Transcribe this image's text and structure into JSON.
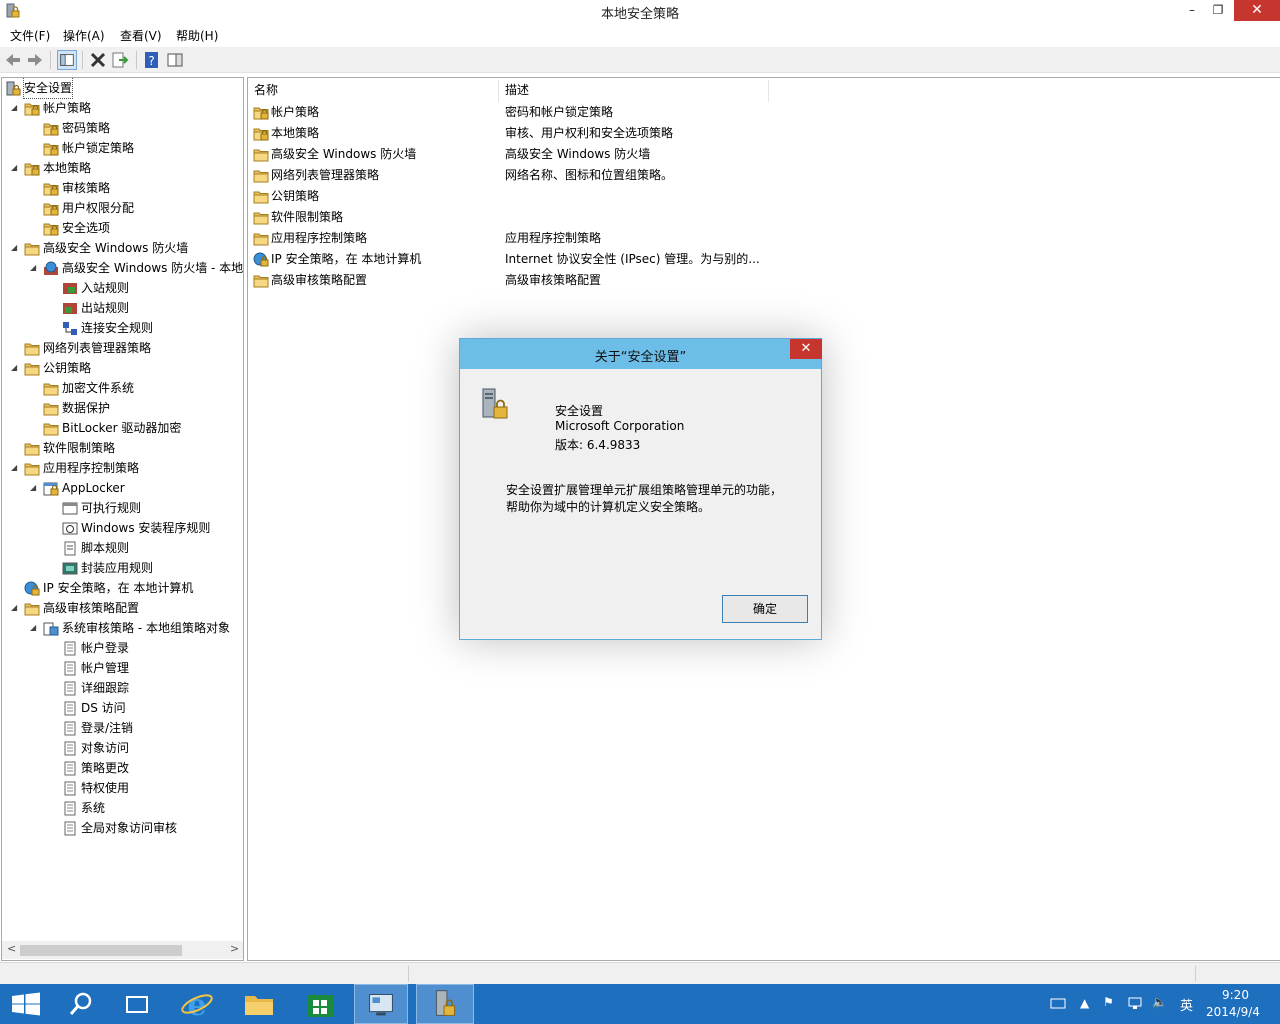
{
  "window": {
    "title": "本地安全策略",
    "minimize": "–",
    "maximize": "❐",
    "close": "✕"
  },
  "menu": [
    "文件(F)",
    "操作(A)",
    "查看(V)",
    "帮助(H)"
  ],
  "tree": [
    {
      "label": "安全设置",
      "depth": 0,
      "toggle": "",
      "icon": "security-settings-icon"
    },
    {
      "label": "帐户策略",
      "depth": 1,
      "toggle": "◢",
      "icon": "folder-lock-icon"
    },
    {
      "label": "密码策略",
      "depth": 2,
      "toggle": "",
      "icon": "folder-lock-icon"
    },
    {
      "label": "帐户锁定策略",
      "depth": 2,
      "toggle": "",
      "icon": "folder-lock-icon"
    },
    {
      "label": "本地策略",
      "depth": 1,
      "toggle": "◢",
      "icon": "folder-lock-icon"
    },
    {
      "label": "审核策略",
      "depth": 2,
      "toggle": "",
      "icon": "folder-lock-icon"
    },
    {
      "label": "用户权限分配",
      "depth": 2,
      "toggle": "",
      "icon": "folder-lock-icon"
    },
    {
      "label": "安全选项",
      "depth": 2,
      "toggle": "",
      "icon": "folder-lock-icon"
    },
    {
      "label": "高级安全 Windows 防火墙",
      "depth": 1,
      "toggle": "◢",
      "icon": "folder-icon"
    },
    {
      "label": "高级安全 Windows 防火墙 - 本地组策略对象",
      "depth": 2,
      "toggle": "◢",
      "icon": "firewall-icon"
    },
    {
      "label": "入站规则",
      "depth": 3,
      "toggle": "",
      "icon": "inbound-rules-icon"
    },
    {
      "label": "出站规则",
      "depth": 3,
      "toggle": "",
      "icon": "outbound-rules-icon"
    },
    {
      "label": "连接安全规则",
      "depth": 3,
      "toggle": "",
      "icon": "connection-rules-icon"
    },
    {
      "label": "网络列表管理器策略",
      "depth": 1,
      "toggle": "",
      "icon": "folder-icon"
    },
    {
      "label": "公钥策略",
      "depth": 1,
      "toggle": "◢",
      "icon": "folder-icon"
    },
    {
      "label": "加密文件系统",
      "depth": 2,
      "toggle": "",
      "icon": "folder-icon"
    },
    {
      "label": "数据保护",
      "depth": 2,
      "toggle": "",
      "icon": "folder-icon"
    },
    {
      "label": "BitLocker 驱动器加密",
      "depth": 2,
      "toggle": "",
      "icon": "folder-icon"
    },
    {
      "label": "软件限制策略",
      "depth": 1,
      "toggle": "",
      "icon": "folder-icon"
    },
    {
      "label": "应用程序控制策略",
      "depth": 1,
      "toggle": "◢",
      "icon": "folder-icon"
    },
    {
      "label": "AppLocker",
      "depth": 2,
      "toggle": "◢",
      "icon": "applocker-icon"
    },
    {
      "label": "可执行规则",
      "depth": 3,
      "toggle": "",
      "icon": "rules-icon"
    },
    {
      "label": "Windows 安装程序规则",
      "depth": 3,
      "toggle": "",
      "icon": "installer-rules-icon"
    },
    {
      "label": "脚本规则",
      "depth": 3,
      "toggle": "",
      "icon": "script-rules-icon"
    },
    {
      "label": "封装应用规则",
      "depth": 3,
      "toggle": "",
      "icon": "packaged-app-rules-icon"
    },
    {
      "label": "IP 安全策略，在 本地计算机",
      "depth": 1,
      "toggle": "",
      "icon": "ip-security-icon"
    },
    {
      "label": "高级审核策略配置",
      "depth": 1,
      "toggle": "◢",
      "icon": "folder-icon"
    },
    {
      "label": "系统审核策略 - 本地组策略对象",
      "depth": 2,
      "toggle": "◢",
      "icon": "audit-policy-icon"
    },
    {
      "label": "帐户登录",
      "depth": 3,
      "toggle": "",
      "icon": "audit-item-icon"
    },
    {
      "label": "帐户管理",
      "depth": 3,
      "toggle": "",
      "icon": "audit-item-icon"
    },
    {
      "label": "详细跟踪",
      "depth": 3,
      "toggle": "",
      "icon": "audit-item-icon"
    },
    {
      "label": "DS 访问",
      "depth": 3,
      "toggle": "",
      "icon": "audit-item-icon"
    },
    {
      "label": "登录/注销",
      "depth": 3,
      "toggle": "",
      "icon": "audit-item-icon"
    },
    {
      "label": "对象访问",
      "depth": 3,
      "toggle": "",
      "icon": "audit-item-icon"
    },
    {
      "label": "策略更改",
      "depth": 3,
      "toggle": "",
      "icon": "audit-item-icon"
    },
    {
      "label": "特权使用",
      "depth": 3,
      "toggle": "",
      "icon": "audit-item-icon"
    },
    {
      "label": "系统",
      "depth": 3,
      "toggle": "",
      "icon": "audit-item-icon"
    },
    {
      "label": "全局对象访问审核",
      "depth": 3,
      "toggle": "",
      "icon": "audit-item-icon"
    }
  ],
  "list": {
    "columns": [
      "名称",
      "描述"
    ],
    "rows": [
      {
        "name": "帐户策略",
        "desc": "密码和帐户锁定策略",
        "icon": "folder-lock-icon"
      },
      {
        "name": "本地策略",
        "desc": "审核、用户权利和安全选项策略",
        "icon": "folder-lock-icon"
      },
      {
        "name": "高级安全 Windows 防火墙",
        "desc": "高级安全 Windows 防火墙",
        "icon": "folder-icon"
      },
      {
        "name": "网络列表管理器策略",
        "desc": "网络名称、图标和位置组策略。",
        "icon": "folder-icon"
      },
      {
        "name": "公钥策略",
        "desc": "",
        "icon": "folder-icon"
      },
      {
        "name": "软件限制策略",
        "desc": "",
        "icon": "folder-icon"
      },
      {
        "name": "应用程序控制策略",
        "desc": "应用程序控制策略",
        "icon": "folder-icon"
      },
      {
        "name": "IP 安全策略，在 本地计算机",
        "desc": "Internet 协议安全性 (IPsec) 管理。为与别的...",
        "icon": "ip-security-icon"
      },
      {
        "name": "高级审核策略配置",
        "desc": "高级审核策略配置",
        "icon": "folder-icon"
      }
    ]
  },
  "dialog": {
    "title": "关于“安全设置”",
    "close": "✕",
    "product": "安全设置",
    "company": "Microsoft Corporation",
    "version": "版本: 6.4.9833",
    "desc_line1": "安全设置扩展管理单元扩展组策略管理单元的功能，",
    "desc_line2": "帮助你为域中的计算机定义安全策略。",
    "ok": "确定"
  },
  "taskbar": {
    "time": "9:20",
    "date": "2014/9/4",
    "ime": "英"
  },
  "colors": {
    "accent": "#1f6fbf",
    "dialog_title": "#6cbde8",
    "close_red": "#c7352f"
  }
}
